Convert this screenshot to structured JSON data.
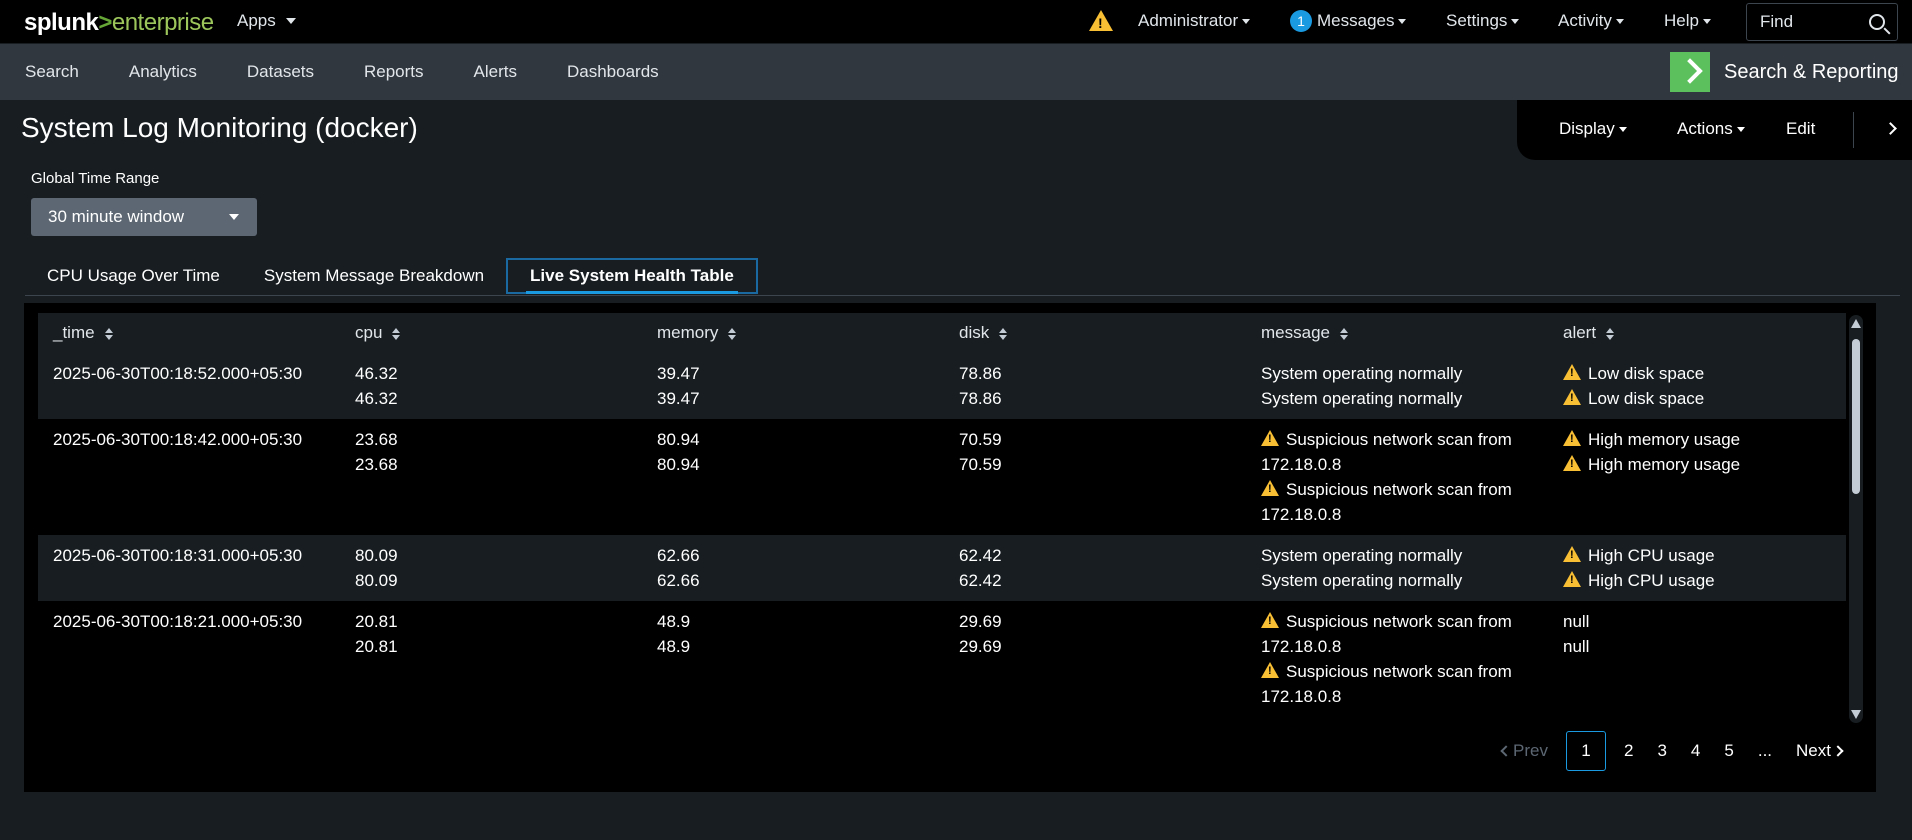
{
  "topbar": {
    "logo_part1": "splunk",
    "logo_part2": ">",
    "logo_part3": "enterprise",
    "apps_label": "Apps",
    "admin_label": "Administrator",
    "messages_count": "1",
    "messages_label": "Messages",
    "settings_label": "Settings",
    "activity_label": "Activity",
    "help_label": "Help",
    "find_placeholder": "Find"
  },
  "appbar": {
    "nav": [
      "Search",
      "Analytics",
      "Datasets",
      "Reports",
      "Alerts",
      "Dashboards"
    ],
    "app_title": "Search & Reporting"
  },
  "dashboard": {
    "title": "System Log Monitoring (docker)",
    "display_label": "Display",
    "actions_label": "Actions",
    "edit_label": "Edit"
  },
  "time_range": {
    "label": "Global Time Range",
    "value": "30 minute window"
  },
  "tabs": [
    {
      "label": "CPU Usage Over Time"
    },
    {
      "label": "System Message Breakdown"
    },
    {
      "label": "Live System Health Table"
    }
  ],
  "table": {
    "columns": [
      "_time",
      "cpu",
      "memory",
      "disk",
      "message",
      "alert"
    ],
    "rows": [
      {
        "time": "2025-06-30T00:18:52.000+05:30",
        "cpu": [
          "46.32",
          "46.32"
        ],
        "memory": [
          "39.47",
          "39.47"
        ],
        "disk": [
          "78.86",
          "78.86"
        ],
        "message": [
          "System operating normally",
          "System operating normally"
        ],
        "alert": [
          "Low disk space",
          "Low disk space"
        ]
      },
      {
        "time": "2025-06-30T00:18:42.000+05:30",
        "cpu": [
          "23.68",
          "23.68"
        ],
        "memory": [
          "80.94",
          "80.94"
        ],
        "disk": [
          "70.59",
          "70.59"
        ],
        "message": [
          "Suspicious network scan from 172.18.0.8",
          "Suspicious network scan from 172.18.0.8"
        ],
        "alert": [
          "High memory usage",
          "High memory usage"
        ]
      },
      {
        "time": "2025-06-30T00:18:31.000+05:30",
        "cpu": [
          "80.09",
          "80.09"
        ],
        "memory": [
          "62.66",
          "62.66"
        ],
        "disk": [
          "62.42",
          "62.42"
        ],
        "message": [
          "System operating normally",
          "System operating normally"
        ],
        "alert": [
          "High CPU usage",
          "High CPU usage"
        ]
      },
      {
        "time": "2025-06-30T00:18:21.000+05:30",
        "cpu": [
          "20.81",
          "20.81"
        ],
        "memory": [
          "48.9",
          "48.9"
        ],
        "disk": [
          "29.69",
          "29.69"
        ],
        "message": [
          "Suspicious network scan from 172.18.0.8",
          "Suspicious network scan from 172.18.0.8"
        ],
        "alert": [
          "null",
          "null"
        ]
      }
    ]
  },
  "pagination": {
    "prev": "Prev",
    "pages": [
      "1",
      "2",
      "3",
      "4",
      "5"
    ],
    "ellipsis": "...",
    "next": "Next"
  },
  "colors": {
    "accent": "#1a9ae1",
    "warning": "#f8be34",
    "brand_green": "#65a637"
  }
}
